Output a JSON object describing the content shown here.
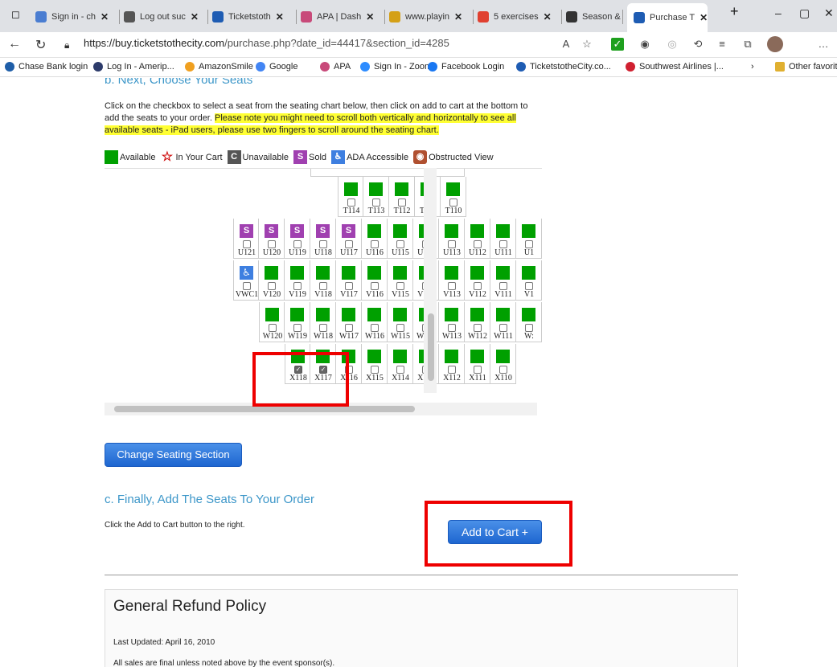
{
  "browser": {
    "tabs": [
      {
        "label": "Sign in - ch",
        "color": "#4a7dd1"
      },
      {
        "label": "Log out suc",
        "color": "#555555"
      },
      {
        "label": "Ticketstoth",
        "color": "#1e5cb3"
      },
      {
        "label": "APA | Dash",
        "color": "#c84a7a"
      },
      {
        "label": "www.playin",
        "color": "#d4a017"
      },
      {
        "label": "5 exercises",
        "color": "#e04030"
      },
      {
        "label": "Season &",
        "color": "#333333"
      },
      {
        "label": "Purchase T",
        "color": "#1e5cb3"
      }
    ],
    "new_tab": "+",
    "window_buttons": {
      "minimize": "–",
      "maximize": "▢",
      "close": "✕"
    },
    "url_host": "https://buy.ticketstothecity.com",
    "url_path": "/purchase.php?date_id=44417&section_id=4285",
    "bookmarks": [
      {
        "label": "Chase Bank login",
        "color": "#1f5ea8"
      },
      {
        "label": "Log In - Amerip...",
        "color": "#2d3b6b"
      },
      {
        "label": "AmazonSmile",
        "color": "#f0a020"
      },
      {
        "label": "Google",
        "color": "#4285f4"
      },
      {
        "label": "APA",
        "color": "#c84a7a"
      },
      {
        "label": "Sign In - Zoom",
        "color": "#2d8cff"
      },
      {
        "label": "Facebook Login",
        "color": "#1877f2"
      },
      {
        "label": "TicketstotheCity.co...",
        "color": "#1e5cb3"
      },
      {
        "label": "Southwest Airlines |...",
        "color": "#d02030"
      },
      {
        "label": "Other favorites",
        "color": "#e0b030"
      }
    ]
  },
  "page": {
    "step_b_title": "b. Next, Choose Your Seats",
    "instr_plain": "Click on the checkbox to select a seat from the seating chart below, then click on add to cart at the bottom to add the seats to your order. ",
    "instr_highlight": "Please note you might need to scroll both vertically and horizontally to see all available seats - iPad users, please use two fingers to scroll around the seating chart.",
    "legend": {
      "available": "Available",
      "in_cart": "In Your Cart",
      "unavailable": "Unavailable",
      "sold": "Sold",
      "ada": "ADA Accessible",
      "obstructed": "Obstructed View",
      "unavailable_glyph": "C",
      "sold_glyph": "S"
    },
    "colors": {
      "available": "#00a000",
      "sold": "#a040b0",
      "ada": "#3e7fe0",
      "unavailable": "#555555",
      "in_cart": "#d01010",
      "obstructed": "#b05030",
      "accent": "#3d97c9"
    },
    "seat_rows": [
      {
        "row": "T",
        "seats": [
          {
            "label": "T114",
            "status": "available",
            "checked": false
          },
          {
            "label": "T113",
            "status": "available",
            "checked": false
          },
          {
            "label": "T112",
            "status": "available",
            "checked": false
          },
          {
            "label": "T111",
            "status": "available",
            "checked": false
          },
          {
            "label": "T110",
            "status": "available",
            "checked": false
          }
        ]
      },
      {
        "row": "U",
        "seats": [
          {
            "label": "U121",
            "status": "sold",
            "checked": false
          },
          {
            "label": "U120",
            "status": "sold",
            "checked": false
          },
          {
            "label": "U119",
            "status": "sold",
            "checked": false
          },
          {
            "label": "U118",
            "status": "sold",
            "checked": false
          },
          {
            "label": "U117",
            "status": "sold",
            "checked": false
          },
          {
            "label": "U116",
            "status": "available",
            "checked": false
          },
          {
            "label": "U115",
            "status": "available",
            "checked": false
          },
          {
            "label": "U114",
            "status": "available",
            "checked": false
          },
          {
            "label": "U113",
            "status": "available",
            "checked": false
          },
          {
            "label": "U112",
            "status": "available",
            "checked": false
          },
          {
            "label": "U111",
            "status": "available",
            "checked": false
          },
          {
            "label": "U1",
            "status": "available",
            "checked": false
          }
        ]
      },
      {
        "row": "V",
        "seats": [
          {
            "label": "VWC1",
            "status": "ada",
            "checked": false
          },
          {
            "label": "V120",
            "status": "available",
            "checked": false
          },
          {
            "label": "V119",
            "status": "available",
            "checked": false
          },
          {
            "label": "V118",
            "status": "available",
            "checked": false
          },
          {
            "label": "V117",
            "status": "available",
            "checked": false
          },
          {
            "label": "V116",
            "status": "available",
            "checked": false
          },
          {
            "label": "V115",
            "status": "available",
            "checked": false
          },
          {
            "label": "V114",
            "status": "available",
            "checked": false
          },
          {
            "label": "V113",
            "status": "available",
            "checked": false
          },
          {
            "label": "V112",
            "status": "available",
            "checked": false
          },
          {
            "label": "V111",
            "status": "available",
            "checked": false
          },
          {
            "label": "V1",
            "status": "available",
            "checked": false
          }
        ]
      },
      {
        "row": "W",
        "seats": [
          {
            "label": "W120",
            "status": "available",
            "checked": false
          },
          {
            "label": "W119",
            "status": "available",
            "checked": false
          },
          {
            "label": "W118",
            "status": "available",
            "checked": false
          },
          {
            "label": "W117",
            "status": "available",
            "checked": false
          },
          {
            "label": "W116",
            "status": "available",
            "checked": false
          },
          {
            "label": "W115",
            "status": "available",
            "checked": false
          },
          {
            "label": "W114",
            "status": "available",
            "checked": false
          },
          {
            "label": "W113",
            "status": "available",
            "checked": false
          },
          {
            "label": "W112",
            "status": "available",
            "checked": false
          },
          {
            "label": "W111",
            "status": "available",
            "checked": false
          },
          {
            "label": "W:",
            "status": "available",
            "checked": false
          }
        ]
      },
      {
        "row": "X",
        "seats": [
          {
            "label": "X118",
            "status": "available",
            "checked": true
          },
          {
            "label": "X117",
            "status": "available",
            "checked": true
          },
          {
            "label": "X116",
            "status": "available",
            "checked": false
          },
          {
            "label": "X115",
            "status": "available",
            "checked": false
          },
          {
            "label": "X114",
            "status": "available",
            "checked": false
          },
          {
            "label": "X113",
            "status": "available",
            "checked": false
          },
          {
            "label": "X112",
            "status": "available",
            "checked": false
          },
          {
            "label": "X111",
            "status": "available",
            "checked": false
          },
          {
            "label": "X110",
            "status": "available",
            "checked": false
          }
        ]
      }
    ],
    "change_section_label": "Change Seating Section",
    "step_c_title": "c. Finally, Add The Seats To Your Order",
    "add_to_cart_instr": "Click the Add to Cart button to the right.",
    "add_to_cart_label": "Add to Cart +",
    "refund": {
      "title": "General Refund Policy",
      "updated": "Last Updated: April 16, 2010",
      "summary": "All sales are final unless noted above by the event sponsor(s)."
    }
  }
}
